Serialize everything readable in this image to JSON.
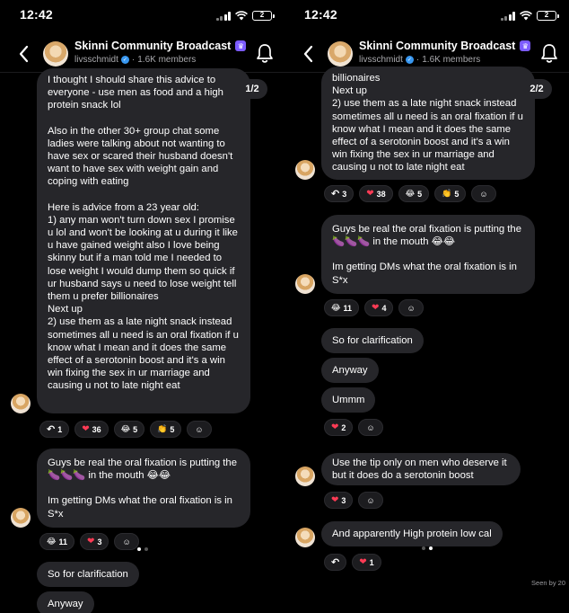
{
  "status": {
    "time": "12:42",
    "battery": "2"
  },
  "header": {
    "title": "Skinni Community Broadcast",
    "owner": "livsschmidt",
    "members": "1.6K members",
    "separator": "·"
  },
  "left": {
    "page": "1/2",
    "msg1": [
      "I thought I should share this advice to everyone - use men as food and a high protein snack lol",
      "Also in the other 30+ group chat some ladies were talking about not wanting to have sex or scared their husband doesn't want to have sex with weight gain and coping with eating",
      "Here is advice from a 23 year old:\n1) any man won't turn down sex I promise u lol and won't be looking at u during it like u have gained weight also I love being skinny but if a man told me I needed to lose weight I would dump them so quick if ur husband says u need to lose weight tell them u prefer billionaires\nNext up\n2) use them as a late night snack instead sometimes all u need is an oral fixation if u know what I mean and it does the same effect of a serotonin boost and it's a win win fixing the sex in ur marriage and causing u not to late night eat"
    ],
    "msg1_reactions": {
      "reply": "1",
      "heart": "36",
      "laugh": "5",
      "clap": "5"
    },
    "msg2": [
      "Guys be real the oral fixation is putting the 🍆🍆🍆 in the mouth 😂😂",
      "Im getting DMs what the oral fixation is in S*x"
    ],
    "msg2_reactions": {
      "laugh": "11",
      "heart": "3"
    },
    "msg3": "So for clarification",
    "msg4": "Anyway"
  },
  "right": {
    "page": "2/2",
    "msg1": "billionaires\nNext up\n2) use them as a late night snack instead sometimes all u need is an oral fixation if u know what I mean and it does the same effect of a serotonin boost and it's a win win fixing the sex in ur marriage and causing u not to late night eat",
    "msg1_reactions": {
      "reply": "3",
      "heart": "38",
      "laugh": "5",
      "clap": "5"
    },
    "msg2": [
      "Guys be real the oral fixation is putting the 🍆🍆🍆 in the mouth 😂😂",
      "Im getting DMs what the oral fixation is in S*x"
    ],
    "msg2_reactions": {
      "laugh": "11",
      "heart": "4"
    },
    "msg3": "So for clarification",
    "msg4": "Anyway",
    "msg5": "Ummm",
    "msg5_reactions": {
      "heart": "2"
    },
    "msg6": "Use the tip only on men who deserve it but it does do a serotonin boost",
    "msg6_reactions": {
      "heart": "3"
    },
    "msg7": "And apparently High protein low cal",
    "msg7_reactions": {
      "heart": "1"
    },
    "seen": "Seen by 20"
  },
  "icons": {
    "heart": "❤",
    "laugh": "😂",
    "clap": "👏",
    "reply": "↶",
    "add_reaction": "☺"
  },
  "colors": {
    "bubble": "#26262a",
    "accent": "#7c5cff",
    "verified": "#3897f0",
    "heart": "#ff3b55"
  }
}
